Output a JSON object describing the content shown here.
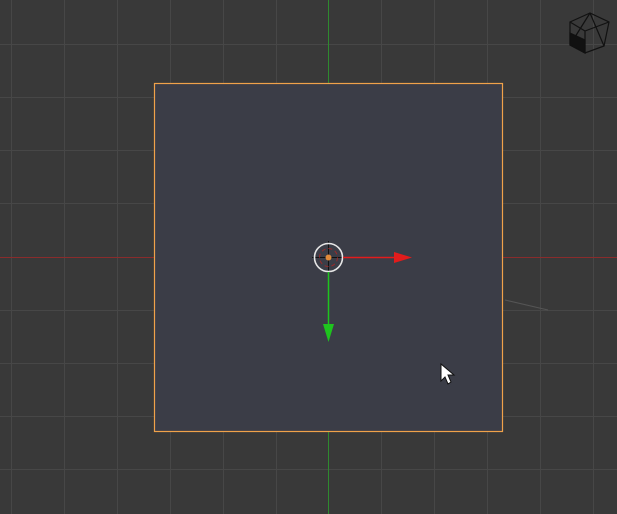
{
  "viewport": {
    "view": "top-orthographic",
    "background_color": "#393939",
    "grid_color": "#474747",
    "x_axis_color": "#8a2c2c",
    "y_axis_color": "#2f8a2f"
  },
  "mesh": {
    "type": "plane",
    "selected": true,
    "face_color": "#3b3d47",
    "outline_color": "#f0a24a"
  },
  "origin": {
    "ring_color": "#e6e6e6",
    "center_color": "#e08a3a"
  },
  "transform_gizmo": {
    "x_handle_color": "#e21c1c",
    "y_handle_color": "#1ec41e",
    "icon": "translate-arrows-icon"
  },
  "navigation": {
    "icon": "view-cube-icon"
  },
  "cursor": {
    "icon": "mouse-pointer-icon"
  }
}
